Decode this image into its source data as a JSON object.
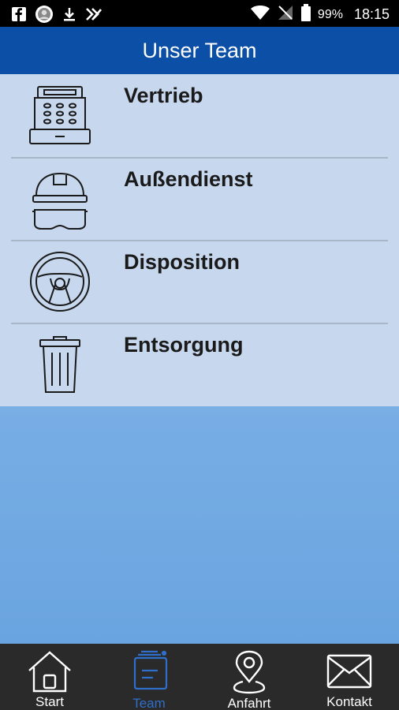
{
  "status_bar": {
    "battery_percent": "99%",
    "time": "18:15",
    "icons": [
      "facebook-icon",
      "avatar-icon",
      "download-icon",
      "notification-icon",
      "wifi-icon",
      "signal-icon",
      "battery-icon"
    ]
  },
  "header": {
    "title": "Unser Team"
  },
  "team": {
    "items": [
      {
        "label": "Vertrieb",
        "icon": "cash-register-icon"
      },
      {
        "label": "Außendienst",
        "icon": "hardhat-goggles-icon"
      },
      {
        "label": "Disposition",
        "icon": "steering-wheel-icon"
      },
      {
        "label": "Entsorgung",
        "icon": "trash-bin-icon"
      }
    ]
  },
  "bottom_nav": {
    "active": "Team",
    "active_color": "#2f6fc9",
    "items": [
      {
        "label": "Start",
        "icon": "home-icon"
      },
      {
        "label": "Team",
        "icon": "team-icon"
      },
      {
        "label": "Anfahrt",
        "icon": "location-pin-icon"
      },
      {
        "label": "Kontakt",
        "icon": "envelope-icon"
      }
    ]
  },
  "colors": {
    "header": "#0b4fa6",
    "list_background": "#c6d7ee",
    "content_gradient_top": "#99c4ee",
    "content_gradient_bottom": "#6aa4e0",
    "nav_background": "#2a2a2a"
  }
}
